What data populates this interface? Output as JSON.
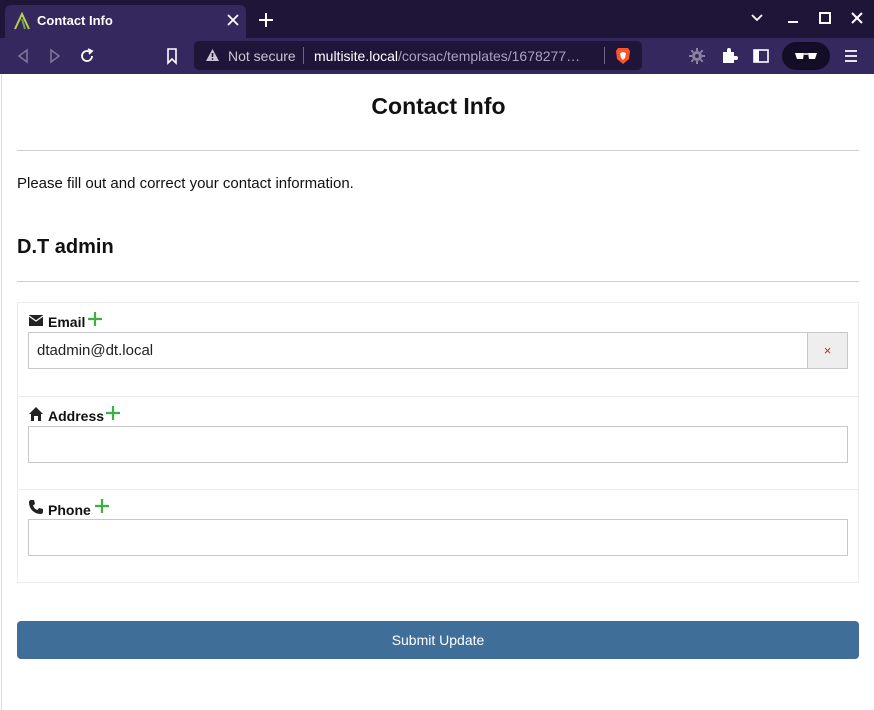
{
  "browser": {
    "tab_title": "Contact Info",
    "url_security": "Not secure",
    "url_host": "multisite.local",
    "url_path": "/corsac/templates/1678277…",
    "icons": {
      "tab": "app-logo-icon",
      "close": "close-icon",
      "new_tab": "plus-icon",
      "back": "back-arrow-icon",
      "forward": "forward-arrow-icon",
      "reload": "reload-icon",
      "bookmark": "bookmark-icon",
      "warning": "warning-icon",
      "shields": "brave-shield-icon",
      "settings": "gear-icon",
      "extensions": "puzzle-icon",
      "sidebar": "sidebar-icon",
      "private": "glasses-icon",
      "menu": "hamburger-menu-icon"
    }
  },
  "page": {
    "title": "Contact Info",
    "intro": "Please fill out and correct your contact information.",
    "user_name": "D.T admin"
  },
  "fields": {
    "email": {
      "label": "Email",
      "value": "dtadmin@dt.local",
      "clear": "×",
      "icon": "envelope-icon"
    },
    "address": {
      "label": "Address",
      "value": "",
      "icon": "home-icon"
    },
    "phone": {
      "label": "Phone",
      "value": "",
      "icon": "phone-icon"
    }
  },
  "submit_label": "Submit Update",
  "colors": {
    "accent": "#3f6f99",
    "add_icon": "#3cb043",
    "clear_icon": "#cc2b2b",
    "browser_bg": "#35285e"
  }
}
